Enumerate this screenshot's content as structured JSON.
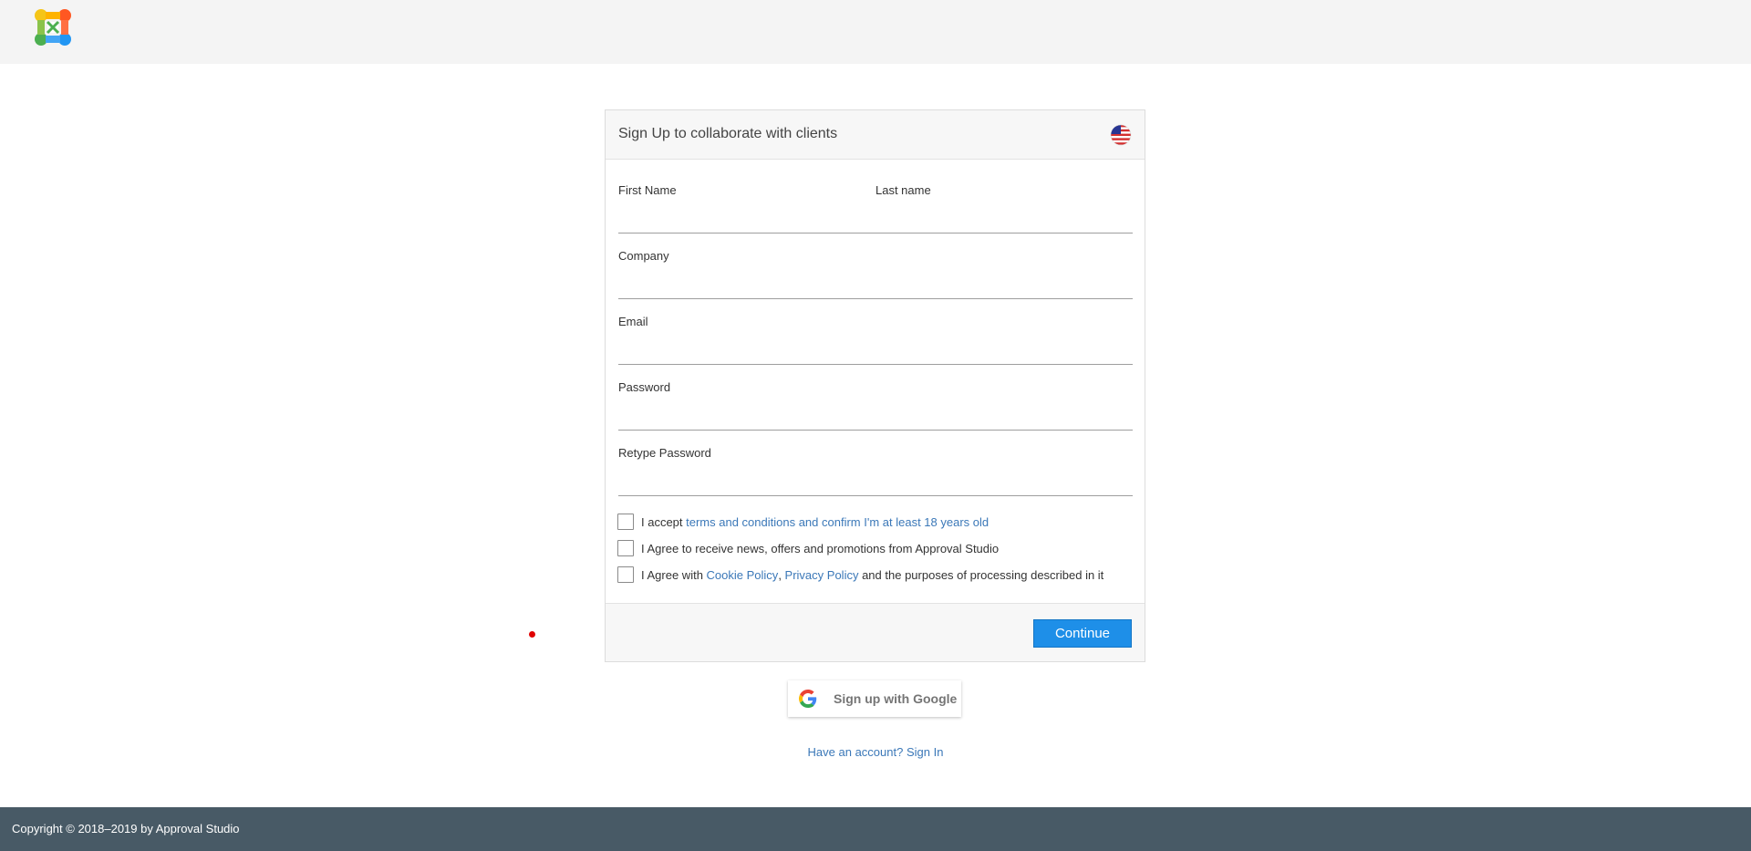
{
  "brand": {
    "logo_icon": "puzzle-logo-icon",
    "colors": [
      "#f5c518",
      "#ff5722",
      "#4caf50",
      "#2196f3"
    ]
  },
  "form": {
    "title": "Sign Up to collaborate with clients",
    "language_icon": "us-flag-icon",
    "fields": {
      "first_name": {
        "label": "First Name",
        "value": ""
      },
      "last_name": {
        "label": "Last name",
        "value": ""
      },
      "company": {
        "label": "Company",
        "value": ""
      },
      "email": {
        "label": "Email",
        "value": ""
      },
      "password": {
        "label": "Password",
        "value": ""
      },
      "retype_password": {
        "label": "Retype Password",
        "value": ""
      }
    },
    "checkboxes": {
      "terms": {
        "prefix": "I accept ",
        "link": "terms and conditions and confirm I'm at least 18 years old",
        "checked": false
      },
      "news": {
        "text": "I Agree to receive news, offers and promotions from Approval Studio",
        "checked": false
      },
      "cookies": {
        "prefix": "I Agree with ",
        "link1": "Cookie Policy",
        "separator": ", ",
        "link2": "Privacy Policy",
        "suffix": " and the purposes of processing described in it",
        "checked": false
      }
    },
    "continue_label": "Continue",
    "accent_color": "#1e8fe8"
  },
  "google": {
    "label": "Sign up with Google",
    "icon": "google-icon"
  },
  "signin": {
    "text": "Have an account? Sign In"
  },
  "footer": {
    "copyright": "Copyright © 2018–2019 by Approval Studio",
    "background": "#485a66"
  }
}
